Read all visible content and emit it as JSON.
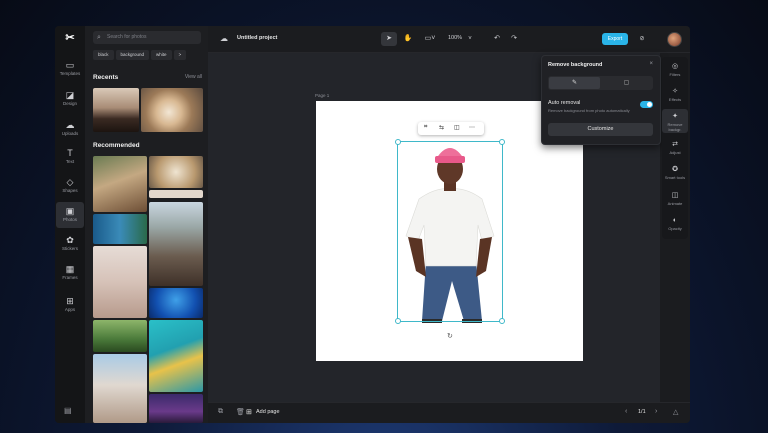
{
  "app": {
    "logo": "✂"
  },
  "rail": {
    "items": [
      {
        "label": "Templates",
        "icon": "▭"
      },
      {
        "label": "Design",
        "icon": "◪"
      },
      {
        "label": "Uploads",
        "icon": "☁"
      },
      {
        "label": "Text",
        "icon": "T"
      },
      {
        "label": "Shapes",
        "icon": "◇"
      },
      {
        "label": "Photos",
        "icon": "▣"
      },
      {
        "label": "Stickers",
        "icon": "✿"
      },
      {
        "label": "Frames",
        "icon": "▦"
      },
      {
        "label": "Apps",
        "icon": "⊞"
      }
    ],
    "footer_icon": "▤"
  },
  "panel": {
    "search_placeholder": "Search for photos",
    "chips": [
      "black",
      "background",
      "white",
      ">"
    ],
    "recents_title": "Recents",
    "view_all": "View all",
    "recommended_title": "Recommended"
  },
  "topbar": {
    "project_title": "Untitled project",
    "zoom": "100%",
    "export_label": "Export"
  },
  "canvas": {
    "page_label": "Page 1"
  },
  "popup": {
    "title": "Remove background",
    "close": "×",
    "auto_removal_label": "Auto removal",
    "auto_removal_desc": "Remove background from photo automatically",
    "customize_label": "Customize"
  },
  "rtools": {
    "items": [
      {
        "label": "Filters",
        "icon": "◎"
      },
      {
        "label": "Effects",
        "icon": "✧"
      },
      {
        "label": "Remove backgr.",
        "icon": "✦"
      },
      {
        "label": "Adjust",
        "icon": "⇄"
      },
      {
        "label": "Smart tools",
        "icon": "✪"
      },
      {
        "label": "Animate",
        "icon": "◫"
      },
      {
        "label": "Opacity",
        "icon": "◐"
      }
    ]
  },
  "bottombar": {
    "add_page_label": "Add page",
    "page_number": "1/1"
  },
  "colors": {
    "accent": "#2ab4e8",
    "selection": "#3fb8c9"
  }
}
